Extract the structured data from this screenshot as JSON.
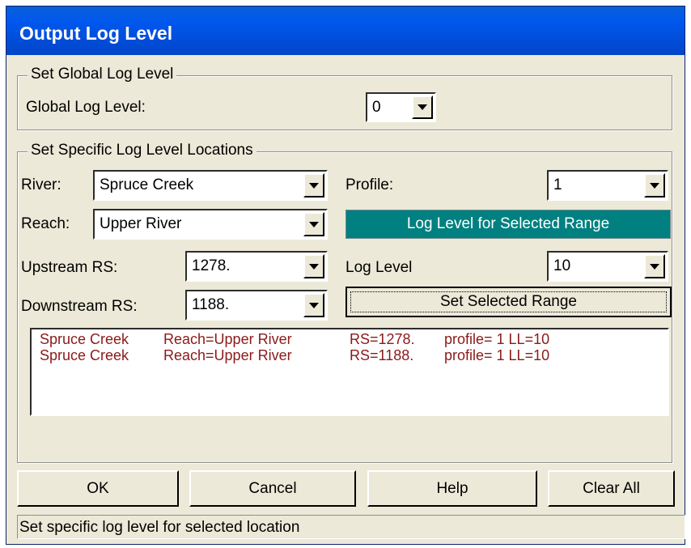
{
  "window": {
    "title": "Output Log Level"
  },
  "global_group": {
    "title": "Set Global Log Level",
    "label": "Global Log Level:",
    "value": "0"
  },
  "specific_group": {
    "title": "Set Specific Log Level Locations",
    "river_label": "River:",
    "river_value": "Spruce Creek",
    "reach_label": "Reach:",
    "reach_value": "Upper River",
    "upstream_label": "Upstream RS:",
    "upstream_value": "1278.",
    "downstream_label": "Downstream RS:",
    "downstream_value": "1188.",
    "profile_label": "Profile:",
    "profile_value": "1",
    "range_header": "Log Level for Selected Range",
    "log_level_label": "Log Level",
    "log_level_value": "10",
    "set_range_button": "Set Selected Range",
    "entries": [
      {
        "river": "Spruce Creek",
        "reach": "Reach=Upper River",
        "rs": "RS=1278.",
        "detail": "profile= 1 LL=10"
      },
      {
        "river": "Spruce Creek",
        "reach": "Reach=Upper River",
        "rs": "RS=1188.",
        "detail": "profile= 1 LL=10"
      }
    ]
  },
  "buttons": {
    "ok": "OK",
    "cancel": "Cancel",
    "help": "Help",
    "clear_all": "Clear All"
  },
  "status_bar": {
    "text": "Set specific log level for selected location"
  },
  "colors": {
    "title_bar": "#0058ee",
    "range_header_bg": "#008080",
    "entry_text": "#8b1a1a",
    "dialog_bg": "#ece9d8"
  }
}
